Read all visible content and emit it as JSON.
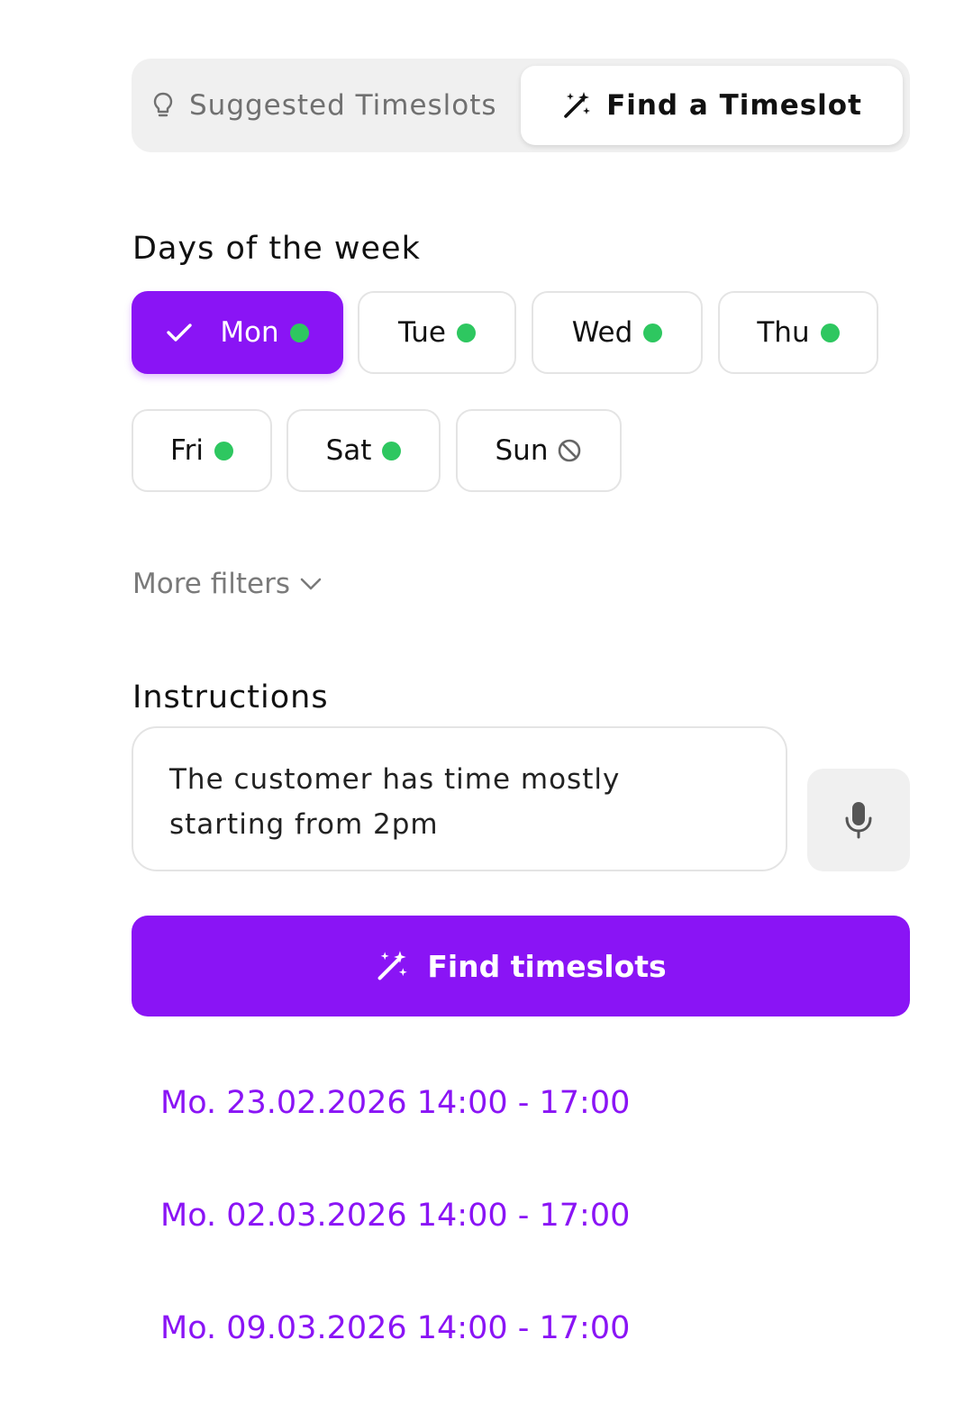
{
  "tabs": {
    "suggested_label": "Suggested Timeslots",
    "find_label": "Find a Timeslot"
  },
  "days": {
    "heading": "Days of the week",
    "items": [
      {
        "label": "Mon",
        "selected": true,
        "available": true
      },
      {
        "label": "Tue",
        "selected": false,
        "available": true
      },
      {
        "label": "Wed",
        "selected": false,
        "available": true
      },
      {
        "label": "Thu",
        "selected": false,
        "available": true
      },
      {
        "label": "Fri",
        "selected": false,
        "available": true
      },
      {
        "label": "Sat",
        "selected": false,
        "available": true
      },
      {
        "label": "Sun",
        "selected": false,
        "available": false
      }
    ]
  },
  "filters": {
    "more_label": "More filters"
  },
  "instructions": {
    "heading": "Instructions",
    "line1": "The customer has time mostly",
    "line2": "starting from 2pm"
  },
  "find_button": {
    "label": "Find timeslots"
  },
  "results": [
    "Mo. 23.02.2026 14:00 - 17:00",
    "Mo. 02.03.2026 14:00 - 17:00",
    "Mo. 09.03.2026 14:00 - 17:00"
  ],
  "colors": {
    "accent": "#8a14f5",
    "available_dot": "#2ec760"
  }
}
